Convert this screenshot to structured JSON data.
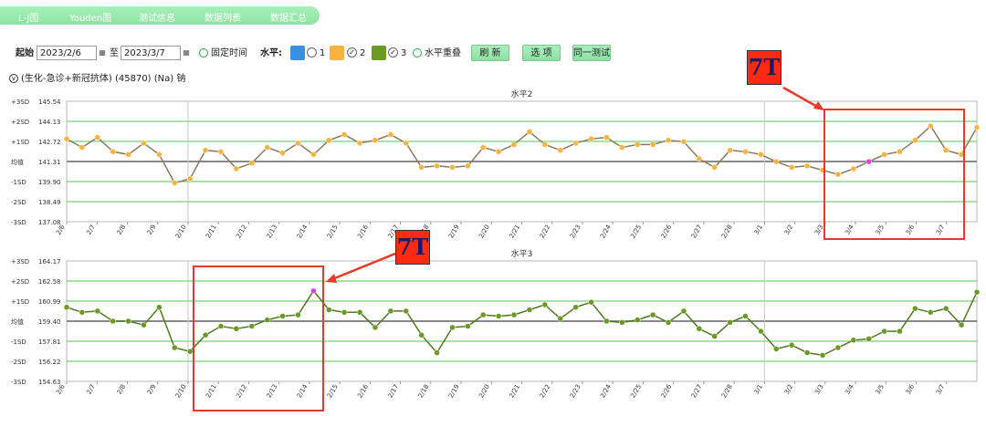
{
  "tabs": [
    "L-J图",
    "Youden图",
    "测试信息",
    "数据列表",
    "数据汇总"
  ],
  "toolbar": {
    "start_label": "起始",
    "start_date": "2023/2/6",
    "to_label": "至",
    "end_date": "2023/3/7",
    "fixed_time_label": "固定时间",
    "level_label": "水平:",
    "level1_label": "1",
    "level2_label": "2",
    "level3_label": "3",
    "overlap_label": "水平重叠",
    "refresh_label": "刷 新",
    "options_label": "选 项",
    "same_test_label": "同一测试",
    "level1_color": "#3b8fe0",
    "level2_color": "#f8b43c",
    "level3_color": "#6a9a22",
    "calendar_icon": "calendar-icon"
  },
  "project": {
    "expand_icon": "chevron-down-icon",
    "text": "(生化-急诊+新冠抗体)  (45870)  (Na) 钠"
  },
  "annotation_text": "7T",
  "chart_data": [
    {
      "type": "line",
      "title": "水平2",
      "mean": 141.31,
      "sd": 1.41,
      "ylim": [
        137.08,
        145.54
      ],
      "y_ticks": [
        {
          "sd": "+3SD",
          "value": "145.54"
        },
        {
          "sd": "+2SD",
          "value": "144.13"
        },
        {
          "sd": "+1SD",
          "value": "142.72"
        },
        {
          "sd": "均值",
          "value": "141.31"
        },
        {
          "sd": "-1SD",
          "value": "139.90"
        },
        {
          "sd": "-2SD",
          "value": "138.49"
        },
        {
          "sd": "-3SD",
          "value": "137.08"
        }
      ],
      "x_ticks": [
        "2/6",
        "2/7",
        "2/8",
        "2/9",
        "2/10",
        "2/11",
        "2/12",
        "2/13",
        "2/14",
        "2/15",
        "2/16",
        "2/17",
        "2/18",
        "2/19",
        "2/20",
        "2/21",
        "2/22",
        "2/23",
        "2/24",
        "2/25",
        "2/26",
        "2/27",
        "2/28",
        "3/1",
        "3/2",
        "3/3",
        "3/4",
        "3/5",
        "3/6",
        "3/7"
      ],
      "line_color": "#8c7a5a",
      "point_color": "#f8b43c",
      "highlight_color": "#e040e0",
      "highlight_index": 52,
      "values": [
        142.9,
        142.3,
        143.0,
        142.0,
        141.8,
        142.6,
        141.8,
        139.8,
        140.1,
        142.1,
        142.0,
        140.8,
        141.2,
        142.3,
        141.9,
        142.6,
        141.8,
        142.8,
        143.2,
        142.6,
        142.8,
        143.2,
        142.6,
        140.9,
        141.0,
        140.9,
        141.0,
        142.3,
        142.0,
        142.5,
        143.4,
        142.5,
        142.1,
        142.6,
        142.9,
        143.0,
        142.3,
        142.5,
        142.5,
        142.8,
        142.7,
        141.5,
        140.9,
        142.1,
        142.0,
        141.8,
        141.3,
        140.9,
        141.0,
        140.7,
        140.4,
        140.8,
        141.3,
        141.8,
        142.0,
        142.8,
        143.8,
        142.1,
        141.8,
        143.7
      ]
    },
    {
      "type": "line",
      "title": "水平3",
      "mean": 159.4,
      "sd": 1.59,
      "ylim": [
        154.63,
        164.17
      ],
      "y_ticks": [
        {
          "sd": "+3SD",
          "value": "164.17"
        },
        {
          "sd": "+2SD",
          "value": "162.58"
        },
        {
          "sd": "+1SD",
          "value": "160.99"
        },
        {
          "sd": "均值",
          "value": "159.40"
        },
        {
          "sd": "-1SD",
          "value": "157.81"
        },
        {
          "sd": "-2SD",
          "value": "156.22"
        },
        {
          "sd": "-3SD",
          "value": "154.63"
        }
      ],
      "x_ticks": [
        "2/6",
        "2/7",
        "2/8",
        "2/9",
        "2/10",
        "2/11",
        "2/12",
        "2/13",
        "2/14",
        "2/15",
        "2/16",
        "2/17",
        "2/18",
        "2/19",
        "2/20",
        "2/21",
        "2/22",
        "2/23",
        "2/24",
        "2/25",
        "2/26",
        "2/27",
        "2/28",
        "3/1",
        "3/2",
        "3/3",
        "3/4",
        "3/5",
        "3/6",
        "3/7"
      ],
      "line_color": "#4e7a1e",
      "point_color": "#6a9a22",
      "highlight_color": "#e040e0",
      "highlight_index": 16,
      "values": [
        160.5,
        160.1,
        160.2,
        159.4,
        159.4,
        159.1,
        160.5,
        157.3,
        157.0,
        158.3,
        159.0,
        158.8,
        159.0,
        159.5,
        159.8,
        159.9,
        161.8,
        160.3,
        160.1,
        160.1,
        158.9,
        160.2,
        160.2,
        158.3,
        156.9,
        158.9,
        159.0,
        159.9,
        159.8,
        159.9,
        160.3,
        160.7,
        159.6,
        160.5,
        160.9,
        159.4,
        159.3,
        159.5,
        159.9,
        159.3,
        160.2,
        158.8,
        158.2,
        159.3,
        159.8,
        158.6,
        157.2,
        157.5,
        156.9,
        156.7,
        157.3,
        157.9,
        158.0,
        158.6,
        158.6,
        160.4,
        160.1,
        160.4,
        159.1,
        161.7
      ]
    }
  ]
}
